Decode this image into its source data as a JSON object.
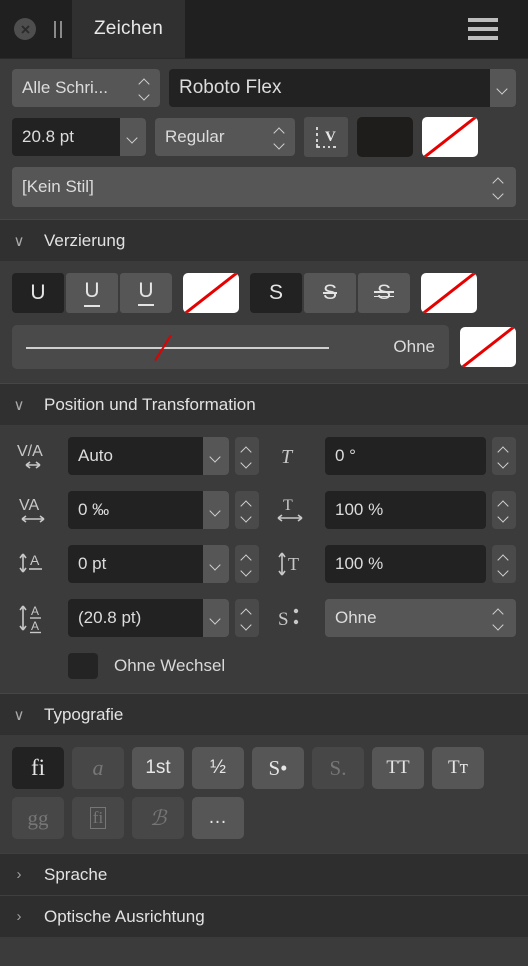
{
  "titlebar": {
    "close_icon": "close-icon",
    "handle_icon": "pause-handle-icon",
    "tab_label": "Zeichen",
    "menu_icon": "hamburger-menu-icon"
  },
  "font": {
    "filter_value": "Alle Schri...",
    "family_value": "Roboto Flex",
    "size_value": "20.8 pt",
    "weight_value": "Regular",
    "glyph_icon": "text-frame-icon",
    "fill_swatch_color": "#1f1c1c",
    "stroke_swatch": "none",
    "style_value": "[Kein Stil]"
  },
  "decoration": {
    "title": "Verzierung",
    "twisty": "∨",
    "underline_buttons": [
      {
        "label": "U",
        "name": "underline-none-button",
        "active": true
      },
      {
        "label": "U",
        "name": "underline-single-button",
        "active": false
      },
      {
        "label": "U",
        "name": "underline-double-button",
        "active": false
      }
    ],
    "underline_color_swatch": "none",
    "strike_buttons": [
      {
        "label": "S",
        "name": "strikethrough-none-button",
        "active": true
      },
      {
        "label": "S",
        "name": "strikethrough-single-button",
        "active": false
      },
      {
        "label": "S",
        "name": "strikethrough-double-button",
        "active": false
      }
    ],
    "strike_color_swatch": "none",
    "line_style_label": "Ohne",
    "line_style_color_swatch": "none"
  },
  "position": {
    "title": "Position und Transformation",
    "twisty": "∨",
    "kerning": {
      "icon": "kerning-icon",
      "label": "V/A",
      "value": "Auto"
    },
    "skew": {
      "icon": "skew-italic-icon",
      "value": "0 °"
    },
    "tracking": {
      "icon": "tracking-icon",
      "label": "VA",
      "value": "0 ‰"
    },
    "hscale": {
      "icon": "horizontal-scale-icon",
      "value": "100 %"
    },
    "baseline": {
      "icon": "baseline-shift-icon",
      "value": "0 pt"
    },
    "vscale": {
      "icon": "vertical-scale-icon",
      "value": "100 %"
    },
    "leading": {
      "icon": "leading-icon",
      "value": "(20.8 pt)"
    },
    "position_special": {
      "icon": "superscript-icon",
      "label": "S:",
      "value": "Ohne"
    },
    "no_break_label": "Ohne Wechsel",
    "no_break_checked": false
  },
  "typography": {
    "title": "Typografie",
    "twisty": "∨",
    "row1": [
      {
        "glyph": "fi",
        "name": "standard-ligatures-button",
        "state": "on"
      },
      {
        "glyph": "a",
        "name": "swash-button",
        "state": "off"
      },
      {
        "glyph": "1st",
        "name": "ordinals-button",
        "state": "normal"
      },
      {
        "glyph": "½",
        "name": "fractions-button",
        "state": "normal"
      },
      {
        "glyph": "S•",
        "name": "superscript-button",
        "state": "normal"
      },
      {
        "glyph": "S.",
        "name": "subscript-button",
        "state": "off"
      },
      {
        "glyph": "TT",
        "name": "all-caps-button",
        "state": "normal"
      },
      {
        "glyph": "Tᴛ",
        "name": "small-caps-button",
        "state": "normal"
      }
    ],
    "row2": [
      {
        "glyph": "gg",
        "name": "alternate-glyphs-button",
        "state": "off"
      },
      {
        "glyph": "fi",
        "name": "discretionary-ligatures-button",
        "state": "off"
      },
      {
        "glyph": "ℬ",
        "name": "contextual-alternates-button",
        "state": "off"
      },
      {
        "glyph": "…",
        "name": "more-options-button",
        "state": "normal"
      }
    ]
  },
  "sections": [
    {
      "title": "Sprache",
      "twisty": "›",
      "name": "section-sprache"
    },
    {
      "title": "Optische Ausrichtung",
      "twisty": "›",
      "name": "section-optische-ausrichtung"
    }
  ]
}
